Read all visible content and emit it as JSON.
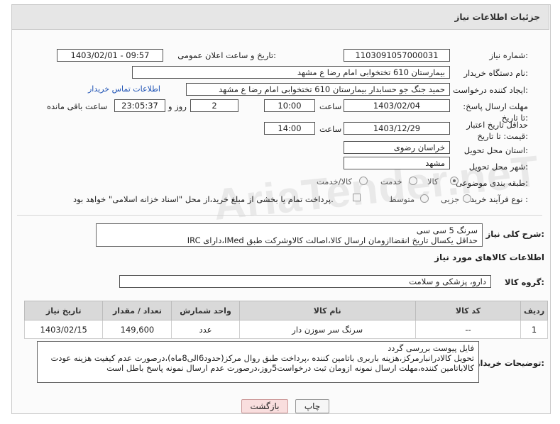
{
  "header": {
    "title": "جزئیات اطلاعات نیاز"
  },
  "fields": {
    "need_number_label": "شماره نیاز:",
    "need_number": "1103091057000031",
    "announce_label": "تاریخ و ساعت اعلان عمومی:",
    "announce_value": "1403/02/01 - 09:57",
    "buyer_org_label": "نام دستگاه خریدار:",
    "buyer_org": "بیمارستان 610 تختخوابی امام رضا ع  مشهد",
    "requester_label": "ایجاد کننده درخواست:",
    "requester": "حمید جنگ جو حسابدار بیمارستان 610 تختخوابی امام رضا ع  مشهد",
    "contact_link": "اطلاعات تماس خریدار",
    "reply_deadline_label": "مهلت ارسال پاسخ: تا تاریخ:",
    "reply_date": "1403/02/04",
    "time_label": "ساعت",
    "reply_time": "10:00",
    "days_value": "2",
    "days_label": "روز و",
    "remaining_time": "23:05:37",
    "remaining_label": "ساعت باقی مانده",
    "price_validity_label": "حداقل تاریخ اعتبار قیمت: تا تاریخ:",
    "price_date": "1403/12/29",
    "price_time": "14:00",
    "province_label": "استان محل تحویل:",
    "province": "خراسان رضوی",
    "city_label": "شهر محل تحویل:",
    "city": "مشهد",
    "category_label": "طبقه بندی موضوعی:",
    "category_options": [
      "کالا",
      "خدمت",
      "کالا/خدمت"
    ],
    "purchase_type_label": "نوع فرآیند خرید :",
    "purchase_options": [
      "جزیی",
      "متوسط"
    ],
    "payment_note": "پرداخت تمام یا بخشی از مبلغ خرید،از محل \"اسناد خزانه اسلامی\" خواهد بود."
  },
  "description": {
    "label": "شرح کلی نیاز:",
    "line1": "سرنگ 5 سی سی",
    "line2": "حداقل یکسال تاریخ انقضاازومان ارسال کالا،اصالت کالاوشرکت طبق IMed،دارای IRC"
  },
  "goods_section": {
    "title": "اطلاعات کالاهای مورد نیاز",
    "group_label": "گروه کالا:",
    "group_value": "دارو، پزشکی و سلامت"
  },
  "table": {
    "headers": [
      "ردیف",
      "کد کالا",
      "نام کالا",
      "واحد شمارش",
      "تعداد / مقدار",
      "تاریخ نیاز"
    ],
    "rows": [
      [
        "1",
        "--",
        "سرنگ سر سوزن دار",
        "عدد",
        "149,600",
        "1403/02/15"
      ]
    ]
  },
  "buyer_notes": {
    "label": "توضیحات خریدار:",
    "line1": "فایل پیوست بررسی گردد",
    "line2": "تحویل کالادرانبارمرکز،هزینه باربری باتامین کننده ،پرداخت طبق روال مرکز(حدود6الی8ماه)،درصورت عدم کیفیت هزینه عودت",
    "line3": "کالاباتامین کننده،مهلت ارسال نمونه ازومان ثبت درخواست5روز،درصورت عدم ارسال نمونه پاسخ باطل است"
  },
  "buttons": {
    "print": "چاپ",
    "back": "بازگشت"
  },
  "watermark": "AriaTender.neT",
  "colors": {
    "header_bg": "#e6e6e6",
    "link": "#1a4fb3",
    "back_btn_bg": "#f9dede"
  }
}
